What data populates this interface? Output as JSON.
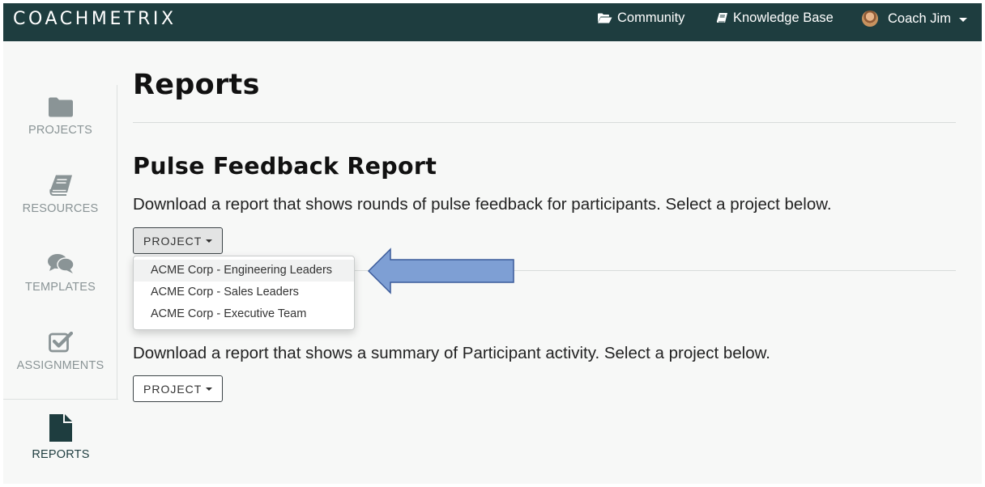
{
  "brand": {
    "logo_text": "COACHMETRIX"
  },
  "topnav": {
    "community_label": "Community",
    "knowledge_base_label": "Knowledge Base",
    "user_name": "Coach Jim"
  },
  "sidebar": {
    "items": [
      {
        "label": "PROJECTS",
        "icon": "folder-icon"
      },
      {
        "label": "RESOURCES",
        "icon": "book-icon"
      },
      {
        "label": "TEMPLATES",
        "icon": "comments-icon"
      },
      {
        "label": "ASSIGNMENTS",
        "icon": "check-square-icon"
      },
      {
        "label": "REPORTS",
        "icon": "file-icon",
        "active": true
      }
    ]
  },
  "main": {
    "title": "Reports",
    "pulse_report": {
      "title": "Pulse Feedback Report",
      "description": "Download a report that shows rounds of pulse feedback for participants. Select a project below.",
      "button_label": "PROJECT",
      "dropdown_options": [
        "ACME Corp - Engineering Leaders",
        "ACME Corp - Sales Leaders",
        "ACME Corp - Executive Team"
      ]
    },
    "activity_report": {
      "description": "Download a report that shows a summary of Participant activity. Select a project below.",
      "button_label": "PROJECT"
    }
  },
  "colors": {
    "topbar": "#1e3d3f",
    "page_background": "#f7f8f7",
    "sidebar_icon": "#8a9496",
    "active_icon": "#1e3d3f",
    "annotation_arrow_fill": "#7e9fd4",
    "annotation_arrow_stroke": "#3a5a9a"
  }
}
